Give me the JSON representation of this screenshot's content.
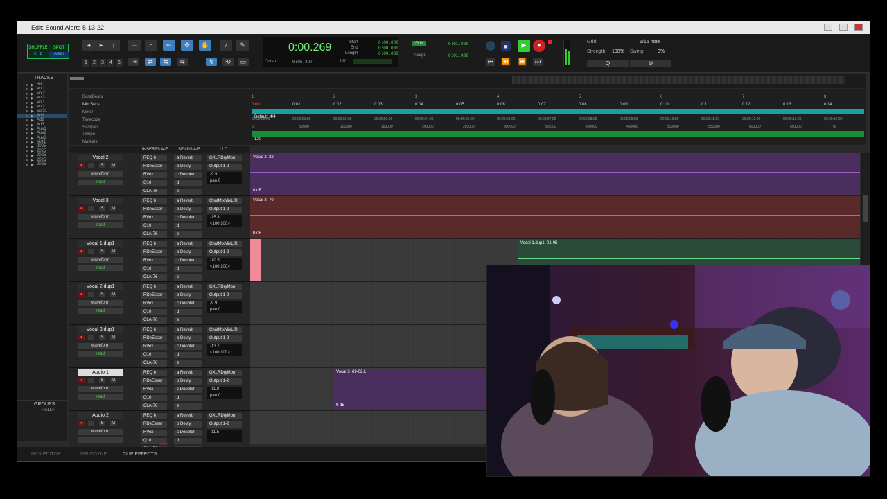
{
  "window": {
    "title": "Edit: Sound Alerts 5-13-22"
  },
  "toolbar": {
    "modes": [
      "SHUFFLE",
      "SPOT",
      "SLIP",
      "GRID"
    ],
    "zoom_presets": [
      "1",
      "2",
      "3",
      "4",
      "5"
    ],
    "counter": {
      "main": "0:00.269",
      "cursor_label": "Cursor",
      "cursor_value": "0:05.397",
      "start_label": "Start",
      "end_label": "End",
      "length_label": "Length",
      "start_value": "0:00.000",
      "end_value": "0:00.000",
      "length_value": "0:00.000",
      "tempo": "120"
    },
    "grid_label": "Grid",
    "grid_value": "0:01.000",
    "nudge_label": "Nudge",
    "nudge_value": "0:01.000",
    "quantize": {
      "grid_label": "Grid:",
      "grid_value": "1/16 note",
      "strength_label": "Strength:",
      "strength_value": "100%",
      "swing_label": "Swing:",
      "swing_value": "0%"
    }
  },
  "tracks_panel": {
    "title": "TRACKS",
    "items": [
      "BikT",
      "Vol1",
      "Vol2",
      "Vol3",
      "Vol1",
      "Vol21",
      "Vol31",
      "Ad1",
      "Ad2",
      "Ad3",
      "Aux1",
      "Aux2",
      "Aux3",
      "Mst1",
      "2025",
      "2025",
      "2025",
      "2025",
      "2025"
    ]
  },
  "groups_panel": {
    "title": "GROUPS",
    "all": "<ALL>"
  },
  "rulers": {
    "labels": [
      "Bars|Beats",
      "Min:Secs",
      "Meter",
      "Timecode",
      "Samples",
      "Tempo",
      "Markers"
    ],
    "minsecs": [
      "0:00",
      "0:01",
      "0:02",
      "0:03",
      "0:04",
      "0:05",
      "0:06",
      "0:07",
      "0:08",
      "0:09",
      "0:10",
      "0:11",
      "0:12",
      "0:13",
      "0:14"
    ],
    "bars": [
      "1",
      "2",
      "3",
      "4",
      "5",
      "6",
      "7",
      "8"
    ],
    "timecode": [
      "00:00:00:00",
      "00:00:01:00",
      "00:00:02:00",
      "00:00:03:00",
      "00:00:04:00",
      "00:00:05:00",
      "00:00:06:00",
      "00:00:07:00",
      "00:00:08:00",
      "00:00:09:00",
      "00:00:10:00",
      "00:00:11:00",
      "00:00:12:00",
      "00:00:13:00",
      "00:00:14:00"
    ],
    "samples": [
      "0",
      "50000",
      "100000",
      "150000",
      "200000",
      "250000",
      "300000",
      "350000",
      "400000",
      "450000",
      "500000",
      "550000",
      "600000",
      "650000",
      "700"
    ],
    "meter": "Default: 4/4",
    "tempo": "120"
  },
  "column_headers": {
    "inserts": "INSERTS A-E",
    "sends": "SENDS A-E",
    "io": "I / O"
  },
  "tracks": [
    {
      "name": "Vocal 2",
      "output_in": "GXLRDryMon",
      "output": "Output 1-2",
      "vol": "-9.9",
      "pan": "0",
      "pan_label": "pan",
      "auto": "waveform",
      "dyn": "read",
      "clip": "Vocal 2_22",
      "clip_gain": "0 dB"
    },
    {
      "name": "Vocal 3",
      "output_in": "ChatMixMixL/R",
      "output": "Output 1-2",
      "vol": "-15.8",
      "pan": "<100  100>",
      "pan_label": "",
      "auto": "waveform",
      "dyn": "read",
      "clip": "Vocal 3_70",
      "clip_gain": "0 dB"
    },
    {
      "name": "Vocal 1.dup1",
      "output_in": "ChatMixMixL/R",
      "output": "Output 1-2",
      "vol": "-10.5",
      "pan": "<100  100>",
      "pan_label": "",
      "auto": "waveform",
      "dyn": "read",
      "clip": "Vocal 1.dup1_01-05",
      "clip_gain": ""
    },
    {
      "name": "Vocal 2.dup1",
      "output_in": "GXLRDryMon",
      "output": "Output 1-2",
      "vol": "-9.9",
      "pan": "0",
      "pan_label": "pan",
      "auto": "waveform",
      "dyn": "read",
      "clip": "",
      "clip_gain": ""
    },
    {
      "name": "Vocal 3.dup1",
      "output_in": "ChatMixMixL/R",
      "output": "Output 1-2",
      "vol": "-13.7",
      "pan": "<100  100>",
      "pan_label": "",
      "auto": "waveform",
      "dyn": "read",
      "clip": "",
      "clip_gain": ""
    },
    {
      "name": "Audio 1",
      "output_in": "GXLRDryMon",
      "output": "Output 1-2",
      "vol": "-11.8",
      "pan": "0",
      "pan_label": "pan",
      "auto": "waveform",
      "dyn": "read",
      "clip": "Vocal 3_69-02.L",
      "clip_gain": "0 dB"
    },
    {
      "name": "Audio 2",
      "output_in": "GXLRDryMon",
      "output": "Output 1-2",
      "vol": "-11.5",
      "pan": "",
      "pan_label": "",
      "auto": "waveform",
      "dyn": "",
      "clip": "",
      "clip_gain": ""
    }
  ],
  "inserts": [
    "REQ 6",
    "RDeEsser",
    "RVox",
    "Q10",
    "CLA-76"
  ],
  "sends": [
    {
      "letter": "a",
      "name": "Reverb"
    },
    {
      "letter": "b",
      "name": "Delay"
    },
    {
      "letter": "c",
      "name": "Doubler"
    },
    {
      "letter": "d",
      "name": ""
    },
    {
      "letter": "e",
      "name": ""
    }
  ],
  "track_buttons": {
    "solo": "S",
    "mute": "M",
    "input": "I"
  },
  "bottom_tabs": [
    "MIDI EDITOR",
    "MELODYNE",
    "CLIP EFFECTS"
  ],
  "footer_label": "record",
  "colors": {
    "purple": "#4a2f5e",
    "red": "#5a2a2a",
    "green": "#6fdc8c",
    "blue_accent": "#3b7fbf",
    "teal": "#14a3a0"
  }
}
